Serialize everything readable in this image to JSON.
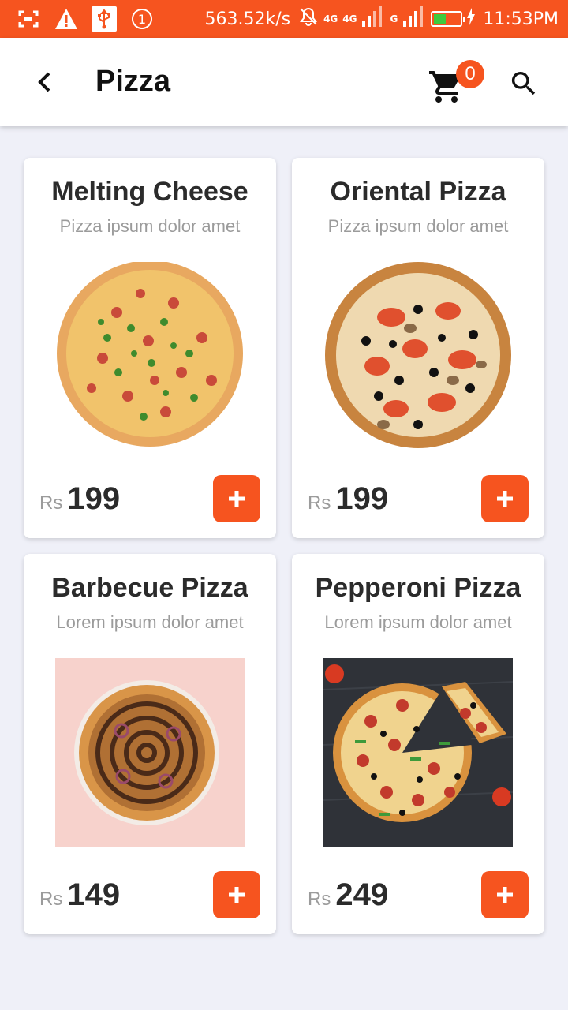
{
  "status_bar": {
    "speed": "563.52k/s",
    "net1": "4G",
    "net2": "4G",
    "net3": "G",
    "time": "11:53PM",
    "notification_count": "1",
    "battery_level": 0.45,
    "icons": [
      "screenshot-icon",
      "warning-icon",
      "usb-icon",
      "notification-count-icon",
      "mute-icon",
      "signal-icon",
      "battery-icon",
      "charging-icon"
    ]
  },
  "app_bar": {
    "title": "Pizza",
    "cart_count": "0",
    "icons": [
      "back-icon",
      "cart-icon",
      "search-icon"
    ]
  },
  "colors": {
    "accent": "#f6541f",
    "background": "#eff0f8",
    "card": "#ffffff",
    "title_text": "#2b2b2b",
    "muted_text": "#9b9b9b"
  },
  "products": [
    {
      "name": "Melting Cheese",
      "subtitle": "Pizza ipsum dolor amet",
      "currency": "Rs",
      "price": "199",
      "add_label": "+"
    },
    {
      "name": "Oriental Pizza",
      "subtitle": "Pizza ipsum dolor amet",
      "currency": "Rs",
      "price": "199",
      "add_label": "+"
    },
    {
      "name": "Barbecue Pizza",
      "subtitle": "Lorem ipsum dolor amet",
      "currency": "Rs",
      "price": "149",
      "add_label": "+"
    },
    {
      "name": "Pepperoni Pizza",
      "subtitle": "Lorem ipsum dolor amet",
      "currency": "Rs",
      "price": "249",
      "add_label": "+"
    }
  ]
}
